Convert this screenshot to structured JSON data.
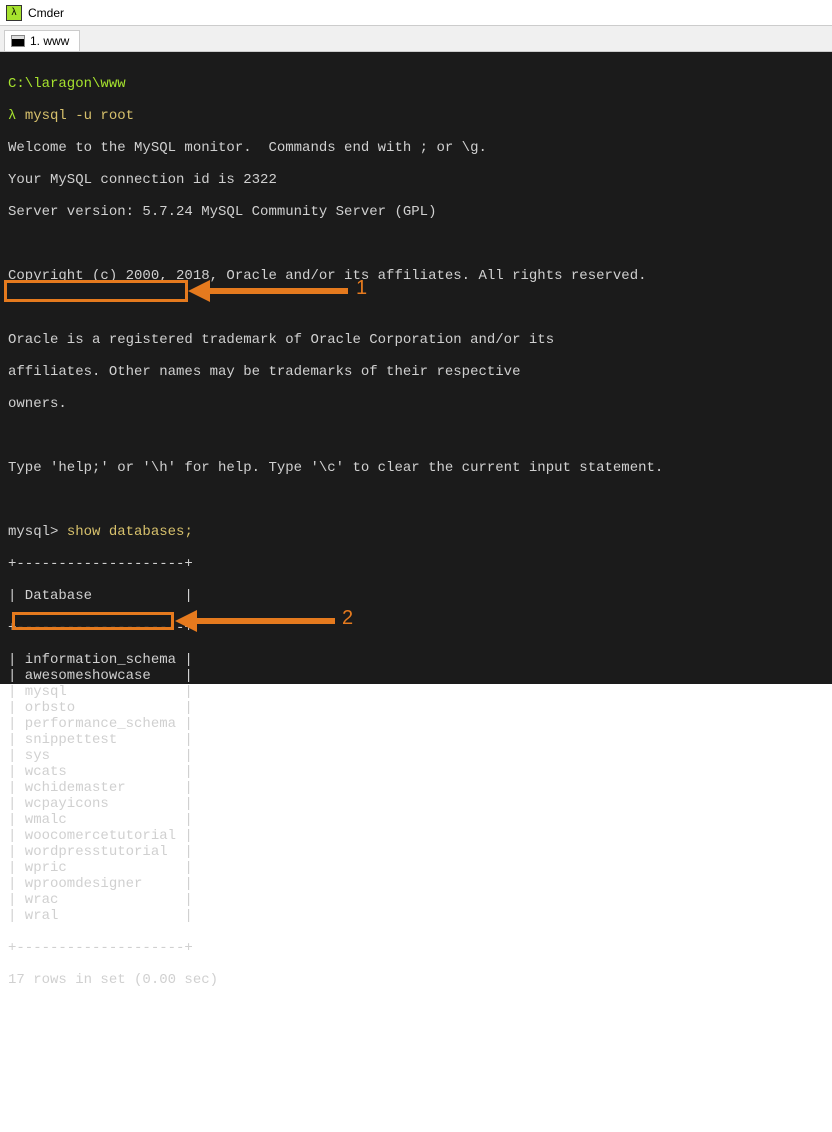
{
  "titlebar": {
    "app_name": "Cmder"
  },
  "tab": {
    "label": "1. www"
  },
  "terminal": {
    "path": "C:\\laragon\\www",
    "prompt_symbol": "λ",
    "cmd_mysql": "mysql -u root",
    "welcome": "Welcome to the MySQL monitor.  Commands end with ; or \\g.",
    "conn_id": "Your MySQL connection id is 2322",
    "server_ver": "Server version: 5.7.24 MySQL Community Server (GPL)",
    "copyright": "Copyright (c) 2000, 2018, Oracle and/or its affiliates. All rights reserved.",
    "trademark1": "Oracle is a registered trademark of Oracle Corporation and/or its",
    "trademark2": "affiliates. Other names may be trademarks of their respective",
    "trademark3": "owners.",
    "help_hint": "Type 'help;' or '\\h' for help. Type '\\c' to clear the current input statement.",
    "prompt_mysql": "mysql>",
    "cmd_show": " show databases;",
    "table_border": "+--------------------+",
    "table_header": "| Database           |",
    "databases": [
      "information_schema",
      "awesomeshowcase",
      "mysql",
      "orbsto",
      "performance_schema",
      "snippettest",
      "sys",
      "wcats",
      "wchidemaster",
      "wcpayicons",
      "wmalc",
      "woocomercetutorial",
      "wordpresstutorial",
      "wpric",
      "wproomdesigner",
      "wrac",
      "wral"
    ],
    "result_summary": "17 rows in set (0.00 sec)"
  },
  "annotations": {
    "label1": "1",
    "label2": "2"
  }
}
